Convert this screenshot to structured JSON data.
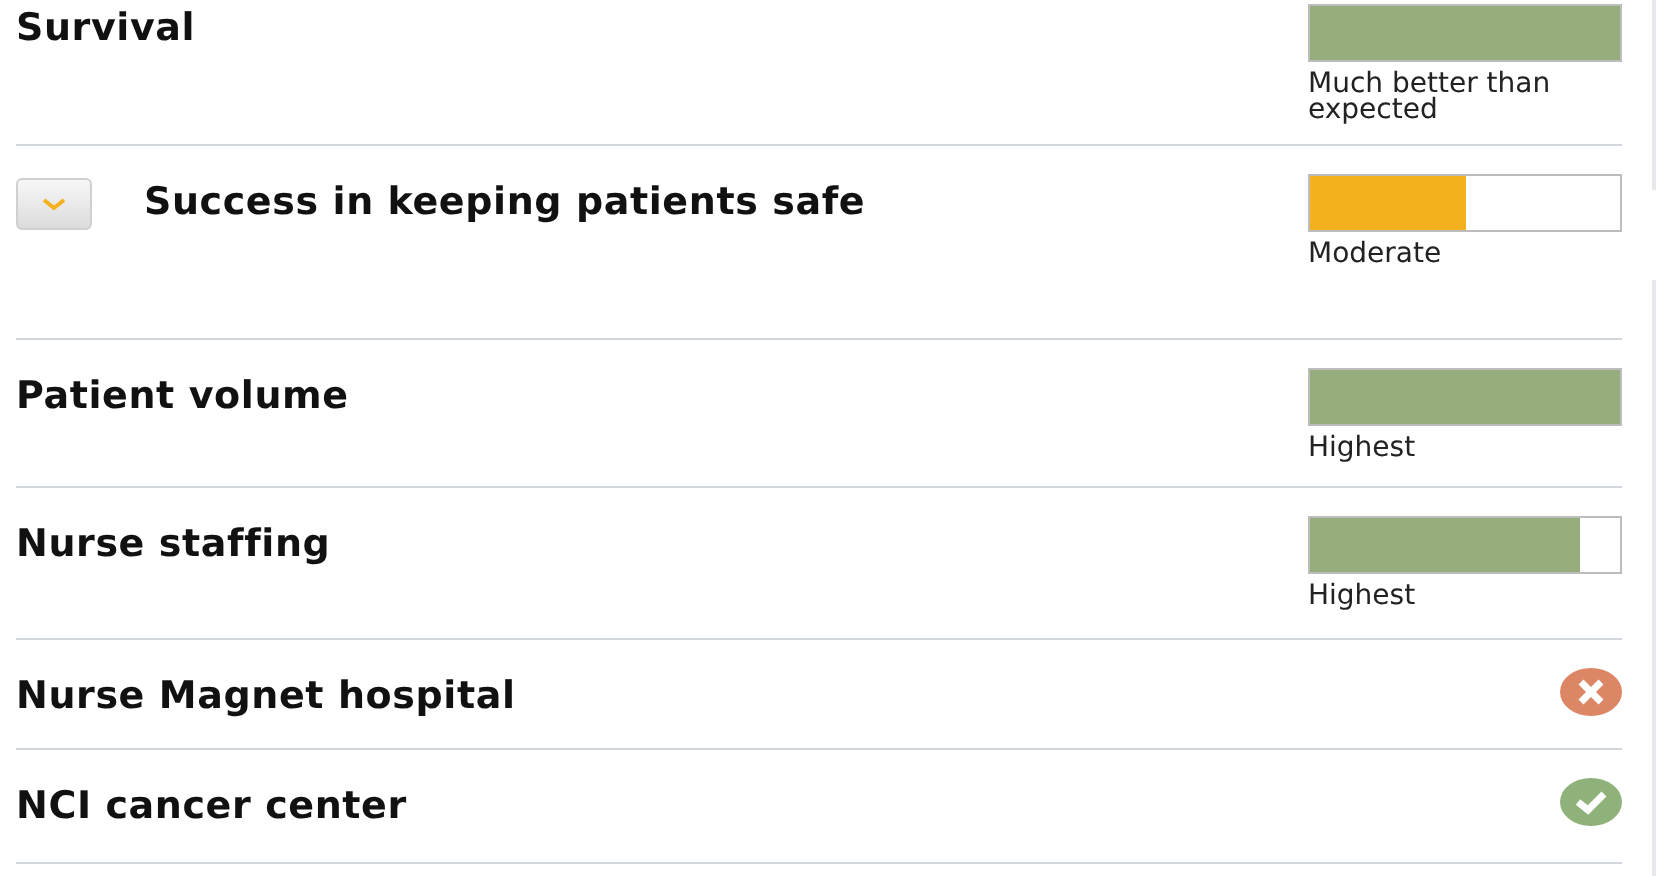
{
  "measures": [
    {
      "kind": "meter",
      "title": "Survival",
      "expandable": false,
      "level": 1,
      "color": "#97ad7d",
      "reading": "Much better than expected"
    },
    {
      "kind": "meter",
      "title": "Success in keeping patients safe",
      "expandable": true,
      "level": 0.5,
      "color": "#f5b01d",
      "reading": "Moderate"
    },
    {
      "kind": "meter",
      "title": "Patient volume",
      "expandable": false,
      "level": 1,
      "color": "#97ad7d",
      "reading": "Highest"
    },
    {
      "kind": "meter",
      "title": "Nurse staffing",
      "expandable": false,
      "level": 0.87,
      "color": "#97ad7d",
      "reading": "Highest"
    },
    {
      "kind": "status",
      "title": "Nurse Magnet hospital",
      "met": false
    },
    {
      "kind": "status",
      "title": "NCI cancer center",
      "met": true
    }
  ]
}
